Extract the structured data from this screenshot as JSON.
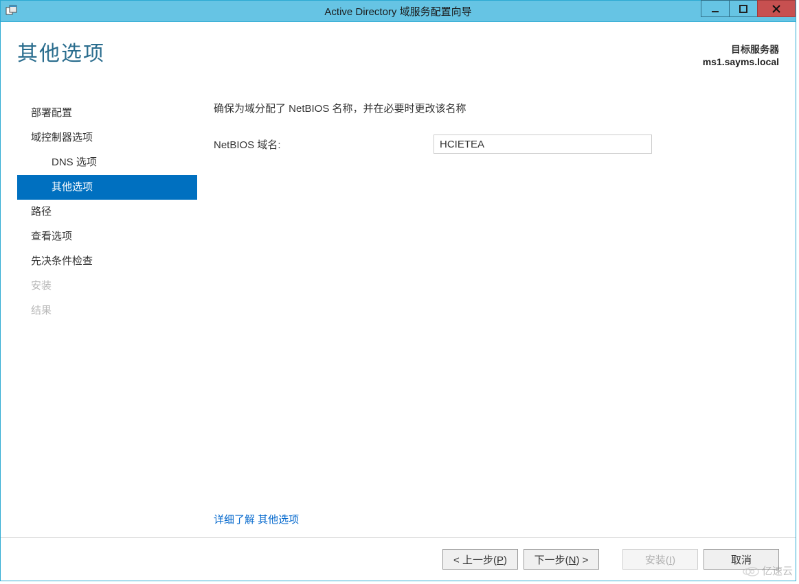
{
  "window": {
    "title": "Active Directory 域服务配置向导"
  },
  "header": {
    "page_title": "其他选项",
    "target_label": "目标服务器",
    "target_host": "ms1.sayms.local"
  },
  "sidebar": {
    "items": [
      {
        "label": "部署配置",
        "selected": false,
        "indent": false,
        "disabled": false
      },
      {
        "label": "域控制器选项",
        "selected": false,
        "indent": false,
        "disabled": false
      },
      {
        "label": "DNS 选项",
        "selected": false,
        "indent": true,
        "disabled": false
      },
      {
        "label": "其他选项",
        "selected": true,
        "indent": true,
        "disabled": false
      },
      {
        "label": "路径",
        "selected": false,
        "indent": false,
        "disabled": false
      },
      {
        "label": "查看选项",
        "selected": false,
        "indent": false,
        "disabled": false
      },
      {
        "label": "先决条件检查",
        "selected": false,
        "indent": false,
        "disabled": false
      },
      {
        "label": "安装",
        "selected": false,
        "indent": false,
        "disabled": true
      },
      {
        "label": "结果",
        "selected": false,
        "indent": false,
        "disabled": true
      }
    ]
  },
  "content": {
    "instruction": "确保为域分配了 NetBIOS 名称，并在必要时更改该名称",
    "netbios_label": "NetBIOS 域名:",
    "netbios_value": "HCIETEA",
    "learn_more_link": "详细了解 其他选项"
  },
  "footer": {
    "prev": {
      "pre": "< 上一步(",
      "mn": "P",
      "post": ")"
    },
    "next": {
      "pre": "下一步(",
      "mn": "N",
      "post": ") >"
    },
    "install": {
      "pre": "安装(",
      "mn": "I",
      "post": ")"
    },
    "cancel": "取消"
  },
  "watermark": "亿速云"
}
